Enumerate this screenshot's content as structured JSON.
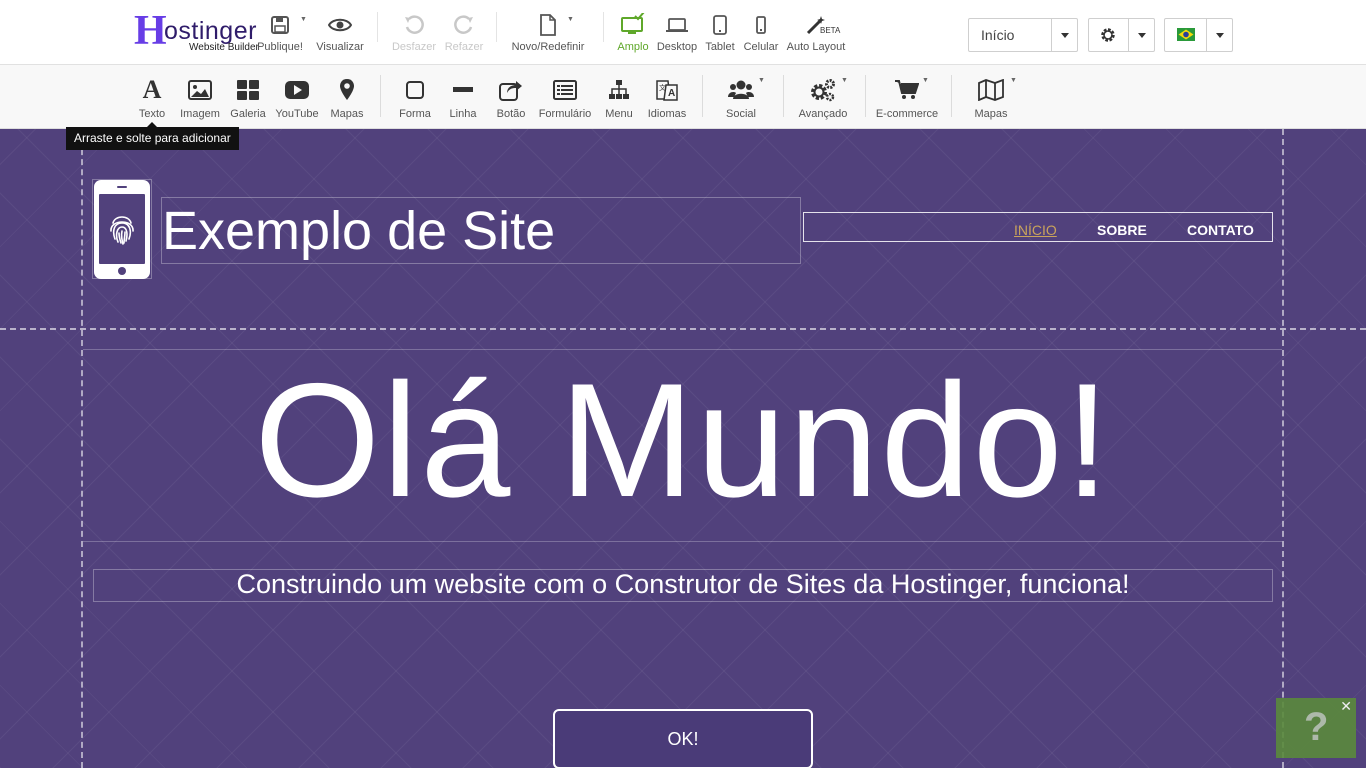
{
  "brand": {
    "name": "Hostinger",
    "tagline": "Website Builder",
    "color": "#673de6"
  },
  "topbar": {
    "publish": {
      "label": "Publique!",
      "icon": "save-icon"
    },
    "preview": {
      "label": "Visualizar",
      "icon": "eye-icon"
    },
    "undo": {
      "label": "Desfazer",
      "icon": "undo-icon",
      "enabled": false
    },
    "redo": {
      "label": "Refazer",
      "icon": "redo-icon",
      "enabled": false
    },
    "new_reset": {
      "label": "Novo/Redefinir",
      "icon": "file-icon"
    },
    "views": [
      {
        "label": "Amplo",
        "icon": "monitor-icon",
        "active": true
      },
      {
        "label": "Desktop",
        "icon": "laptop-icon",
        "active": false
      },
      {
        "label": "Tablet",
        "icon": "tablet-icon",
        "active": false
      },
      {
        "label": "Celular",
        "icon": "phone-icon",
        "active": false
      },
      {
        "label": "Auto Layout",
        "icon": "magic-wand-icon",
        "badge": "BETA",
        "active": false
      }
    ],
    "page_select": {
      "value": "Início"
    },
    "settings": {
      "icon": "gear-icon"
    },
    "language": {
      "icon": "brazil-flag-icon"
    },
    "active_color": "#5fa82a"
  },
  "toolbar": {
    "items": [
      {
        "label": "Texto",
        "icon": "text-icon"
      },
      {
        "label": "Imagem",
        "icon": "image-icon"
      },
      {
        "label": "Galeria",
        "icon": "gallery-icon"
      },
      {
        "label": "YouTube",
        "icon": "youtube-icon"
      },
      {
        "label": "Mapas",
        "icon": "map-pin-icon"
      },
      {
        "label": "Forma",
        "icon": "shape-icon"
      },
      {
        "label": "Linha",
        "icon": "line-icon"
      },
      {
        "label": "Botão",
        "icon": "share-button-icon"
      },
      {
        "label": "Formulário",
        "icon": "form-icon"
      },
      {
        "label": "Menu",
        "icon": "sitemap-icon"
      },
      {
        "label": "Idiomas",
        "icon": "translate-icon"
      },
      {
        "label": "Social",
        "icon": "users-icon"
      },
      {
        "label": "Avançado",
        "icon": "gears-icon"
      },
      {
        "label": "E-commerce",
        "icon": "cart-icon"
      },
      {
        "label": "Mapas",
        "icon": "map-icon"
      }
    ],
    "tooltip": "Arraste e solte para adicionar"
  },
  "site": {
    "background": "#51417c",
    "logo_icon": "fingerprint-phone-icon",
    "title": "Exemplo de Site",
    "nav": [
      {
        "label": "INÍCIO",
        "current": true
      },
      {
        "label": "SOBRE",
        "current": false
      },
      {
        "label": "CONTATO",
        "current": false
      }
    ],
    "nav_current_color": "#c9a35b",
    "hero": "Olá Mundo!",
    "subtitle": "Construindo um website com o Construtor de Sites da Hostinger, funciona!",
    "button": "OK!"
  },
  "help": {
    "label": "?",
    "close": "✕"
  }
}
